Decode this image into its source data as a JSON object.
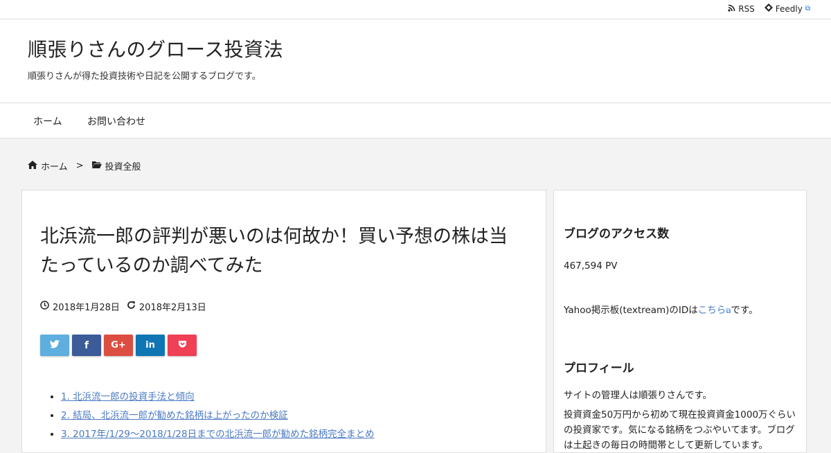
{
  "topbar": {
    "rss_label": "RSS",
    "feedly_label": "Feedly"
  },
  "header": {
    "site_title": "順張りさんのグロース投資法",
    "site_description": "順張りさんが得た投資技術や日記を公開するブログです。"
  },
  "nav": {
    "items": [
      {
        "label": "ホーム"
      },
      {
        "label": "お問い合わせ"
      }
    ]
  },
  "breadcrumb": {
    "home": "ホーム",
    "separator": ">",
    "category": "投資全般"
  },
  "post": {
    "title": "北浜流一郎の評判が悪いのは何故か！買い予想の株は当たっているのか調べてみた",
    "published": "2018年1月28日",
    "updated": "2018年2月13日",
    "share_buttons": [
      {
        "icon": "twitter-icon",
        "glyph": "🐦",
        "color": "#5eaedf"
      },
      {
        "icon": "facebook-icon",
        "glyph": "f",
        "color": "#3b5b99"
      },
      {
        "icon": "google-plus-icon",
        "glyph": "G+",
        "color": "#dc4e41"
      },
      {
        "icon": "linkedin-icon",
        "glyph": "in",
        "color": "#0f76b3"
      },
      {
        "icon": "pocket-icon",
        "glyph": "⌄",
        "color": "#ef4056"
      }
    ],
    "toc": [
      "1. 北浜流一郎の投資手法と傾向",
      "2. 結局、北浜流一郎が勧めた銘柄は上がったのか検証",
      "3. 2017年/1/29～2018/1/28日までの北浜流一郎が勧めた銘柄完全まとめ"
    ]
  },
  "sidebar": {
    "access_heading": "ブログのアクセス数",
    "pv": "467,594 PV",
    "yahoo_text_before": "Yahoo掲示板(textream)のIDは",
    "yahoo_link": "こちら",
    "yahoo_text_after": "です。",
    "profile_heading": "プロフィール",
    "profile_line1": "サイトの管理人は順張りさんです。",
    "profile_line2": "投資資金50万円から初めて現在投資資金1000万ぐらいの投資家です。気になる銘柄をつぶやいてます。ブログは土起きの毎日の時間帯として更新しています。"
  },
  "colors": {
    "link": "#4a7ac4",
    "background": "#f3f3f3"
  }
}
